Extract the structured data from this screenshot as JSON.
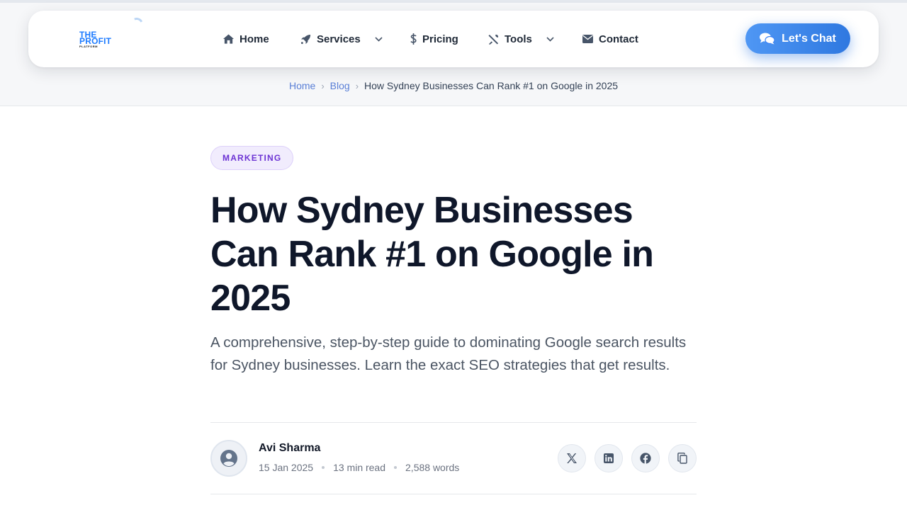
{
  "brand": {
    "logo_line1": "THE",
    "logo_line2": "PROFIT",
    "logo_line3": "PLATFORM"
  },
  "nav": {
    "items": [
      {
        "label": "Home",
        "icon": "home-icon"
      },
      {
        "label": "Services",
        "icon": "rocket-icon",
        "dropdown": true
      },
      {
        "label": "Pricing",
        "icon": "dollar-icon"
      },
      {
        "label": "Tools",
        "icon": "tools-icon",
        "dropdown": true
      },
      {
        "label": "Contact",
        "icon": "envelope-icon"
      }
    ],
    "cta_label": "Let's Chat",
    "cta_icon": "comments-icon"
  },
  "breadcrumb": {
    "items": [
      "Home",
      "Blog"
    ],
    "current": "How Sydney Businesses Can Rank #1 on Google in 2025"
  },
  "article": {
    "category": "MARKETING",
    "title": "How Sydney Businesses Can Rank #1 on Google in 2025",
    "subtitle": "A comprehensive, step-by-step guide to dominating Google search results for Sydney businesses. Learn the exact SEO strategies that get results.",
    "author": "Avi Sharma",
    "date": "15 Jan 2025",
    "read_time": "13 min read",
    "word_count": "2,588 words"
  },
  "share": [
    "x-icon",
    "linkedin-icon",
    "facebook-icon",
    "copy-icon"
  ],
  "colors": {
    "accent": "#3b82f6",
    "category": "#6d34d4",
    "link": "#5a7fd6"
  }
}
